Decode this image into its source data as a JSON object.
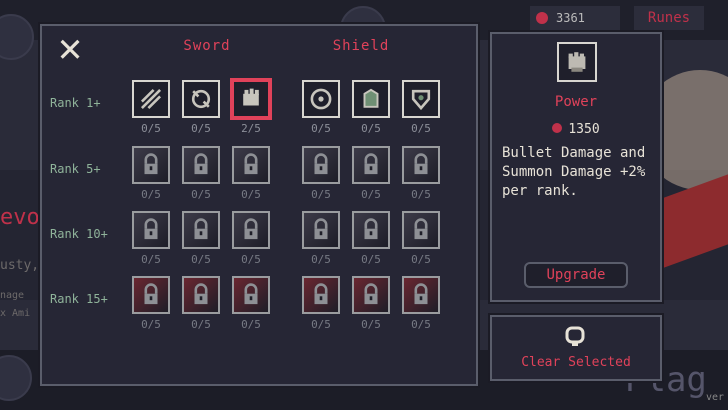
{
  "background": {
    "currency_value": "3361",
    "runes_tab": "Runes",
    "title_fragment": "evo",
    "line1": "usty,",
    "line2": "nage",
    "line3": "x Ami",
    "big_text": "Plag",
    "version": "ver"
  },
  "panel": {
    "close_label": "✕",
    "columns": [
      "Sword",
      "Shield"
    ],
    "ranks": [
      "Rank 1+",
      "Rank 5+",
      "Rank 10+",
      "Rank 15+"
    ],
    "counts": [
      [
        "0/5",
        "0/5",
        "2/5",
        "0/5",
        "0/5",
        "0/5"
      ],
      [
        "0/5",
        "0/5",
        "0/5",
        "0/5",
        "0/5",
        "0/5"
      ],
      [
        "0/5",
        "0/5",
        "0/5",
        "0/5",
        "0/5",
        "0/5"
      ],
      [
        "0/5",
        "0/5",
        "0/5",
        "0/5",
        "0/5",
        "0/5"
      ]
    ]
  },
  "detail": {
    "name": "Power",
    "cost": "1350",
    "description": "Bullet Damage and Summon Damage +2% per rank.",
    "upgrade_label": "Upgrade",
    "icon": "fist-icon"
  },
  "clear": {
    "label": "Clear Selected",
    "icon": "clear-icon"
  },
  "colors": {
    "accent": "#e0425a",
    "rank_label": "#8fb39a",
    "panel_bg": "#262635"
  }
}
